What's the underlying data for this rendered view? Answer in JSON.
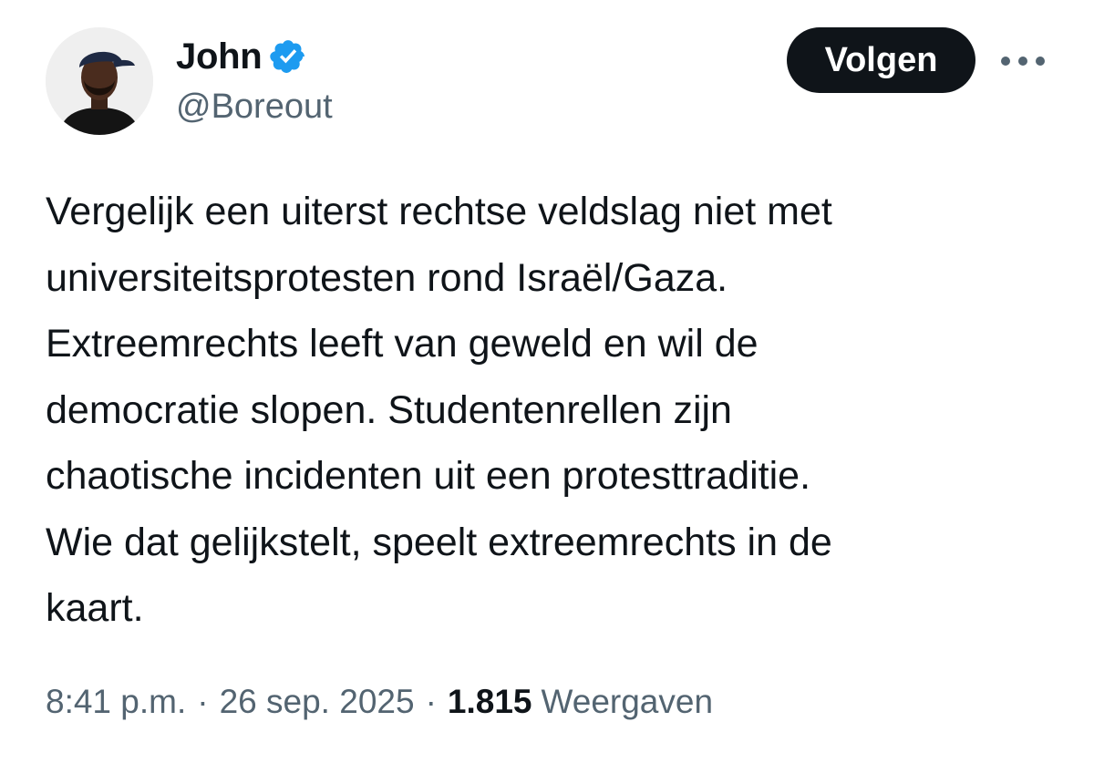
{
  "author": {
    "display_name": "John",
    "handle": "@Boreout",
    "verified": true,
    "verified_color": "#1d9bf0",
    "avatar": "profile-photo"
  },
  "actions": {
    "follow_label": "Volgen",
    "more_icon": "more-horizontal-icon"
  },
  "tweet": {
    "lines": [
      "Vergelijk een uiterst rechtse veldslag niet met",
      "universiteitsprotesten rond Israël/Gaza.",
      "Extreemrechts leeft van geweld en wil de",
      "democratie slopen. Studentenrellen zijn",
      "chaotische incidenten uit een protesttraditie.",
      "Wie dat gelijkstelt, speelt extreemrechts in de",
      "kaart."
    ]
  },
  "meta": {
    "time": "8:41 p.m.",
    "separator": "·",
    "date": "26 sep. 2025",
    "views_count": "1.815",
    "views_label": "Weergaven"
  },
  "colors": {
    "text_primary": "#0f1419",
    "text_secondary": "#536471",
    "button_bg": "#0f1419",
    "button_text": "#ffffff"
  }
}
